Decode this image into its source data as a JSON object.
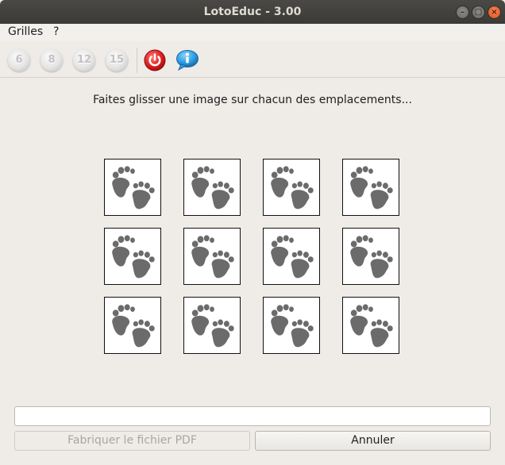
{
  "window": {
    "title": "LotoEduc - 3.00"
  },
  "menubar": {
    "items": [
      "Grilles",
      "?"
    ]
  },
  "toolbar": {
    "grid_buttons": [
      "6",
      "8",
      "12",
      "15"
    ],
    "power_icon": "power-icon",
    "info_icon": "info-icon",
    "accent_red": "#e02020",
    "accent_blue": "#2a9be0"
  },
  "main": {
    "instruction": "Faites glisser une image sur chacun des emplacements...",
    "grid": {
      "rows": 3,
      "cols": 4,
      "placeholder_icon": "footprints-icon"
    }
  },
  "footer": {
    "path_value": "",
    "make_pdf_label": "Fabriquer le fichier PDF",
    "cancel_label": "Annuler"
  }
}
